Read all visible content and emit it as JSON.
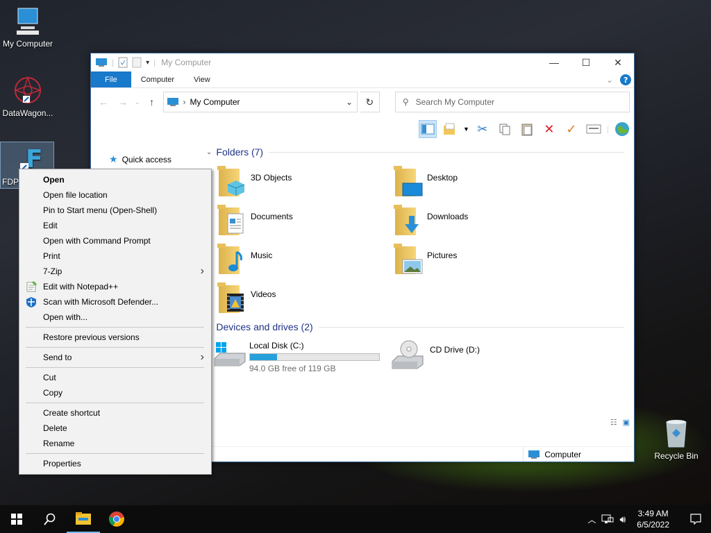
{
  "desktop": {
    "icons": [
      {
        "label": "My Computer",
        "icon": "computer-icon"
      },
      {
        "label": "DataWagon...",
        "icon": "datawagon-icon"
      },
      {
        "label": "FDP",
        "icon": "fdp-shortcut-icon"
      },
      {
        "label": "Recycle Bin",
        "icon": "recycle-bin-icon"
      }
    ]
  },
  "window": {
    "title": "My Computer",
    "controls": {
      "minimize": "—",
      "maximize": "☐",
      "close": "✕"
    },
    "ribbon": {
      "tabs": [
        "File",
        "Computer",
        "View"
      ]
    },
    "address": {
      "path": "My Computer",
      "search_placeholder": "Search My Computer"
    },
    "sidebar": {
      "quick_access": "Quick access"
    },
    "folders_header": "Folders (7)",
    "folders": [
      {
        "name": "3D Objects",
        "icon": "3d-objects-icon"
      },
      {
        "name": "Desktop",
        "icon": "desktop-folder-icon"
      },
      {
        "name": "Documents",
        "icon": "documents-icon"
      },
      {
        "name": "Downloads",
        "icon": "downloads-icon"
      },
      {
        "name": "Music",
        "icon": "music-icon"
      },
      {
        "name": "Pictures",
        "icon": "pictures-icon"
      },
      {
        "name": "Videos",
        "icon": "videos-icon"
      }
    ],
    "drives_header": "Devices and drives (2)",
    "drives": [
      {
        "name": "Local Disk (C:)",
        "free_text": "94.0 GB free of 119 GB",
        "used_fraction": 0.21,
        "icon": "local-disk-icon"
      },
      {
        "name": "CD Drive (D:)",
        "icon": "cd-drive-icon"
      }
    ],
    "status": {
      "location": "Computer"
    }
  },
  "context_menu": {
    "items": [
      {
        "label": "Open",
        "bold": true
      },
      {
        "label": "Open file location"
      },
      {
        "label": "Pin to Start menu (Open-Shell)"
      },
      {
        "label": "Edit"
      },
      {
        "label": "Open with Command Prompt"
      },
      {
        "label": "Print"
      },
      {
        "label": "7-Zip",
        "submenu": true
      },
      {
        "label": "Edit with Notepad++",
        "icon": "notepad-plus-plus-icon"
      },
      {
        "label": "Scan with Microsoft Defender...",
        "icon": "defender-icon"
      },
      {
        "label": "Open with..."
      },
      {
        "label": "Restore previous versions"
      },
      {
        "label": "Send to",
        "submenu": true
      },
      {
        "label": "Cut"
      },
      {
        "label": "Copy"
      },
      {
        "label": "Create shortcut"
      },
      {
        "label": "Delete"
      },
      {
        "label": "Rename"
      },
      {
        "label": "Properties"
      }
    ]
  },
  "taskbar": {
    "time": "3:49 AM",
    "date": "6/5/2022",
    "apps": [
      "start-icon",
      "search-icon",
      "file-explorer-icon",
      "chrome-icon"
    ]
  },
  "colors": {
    "accent": "#1979ca",
    "progress": "#26a0da",
    "group_header": "#1e3287"
  }
}
